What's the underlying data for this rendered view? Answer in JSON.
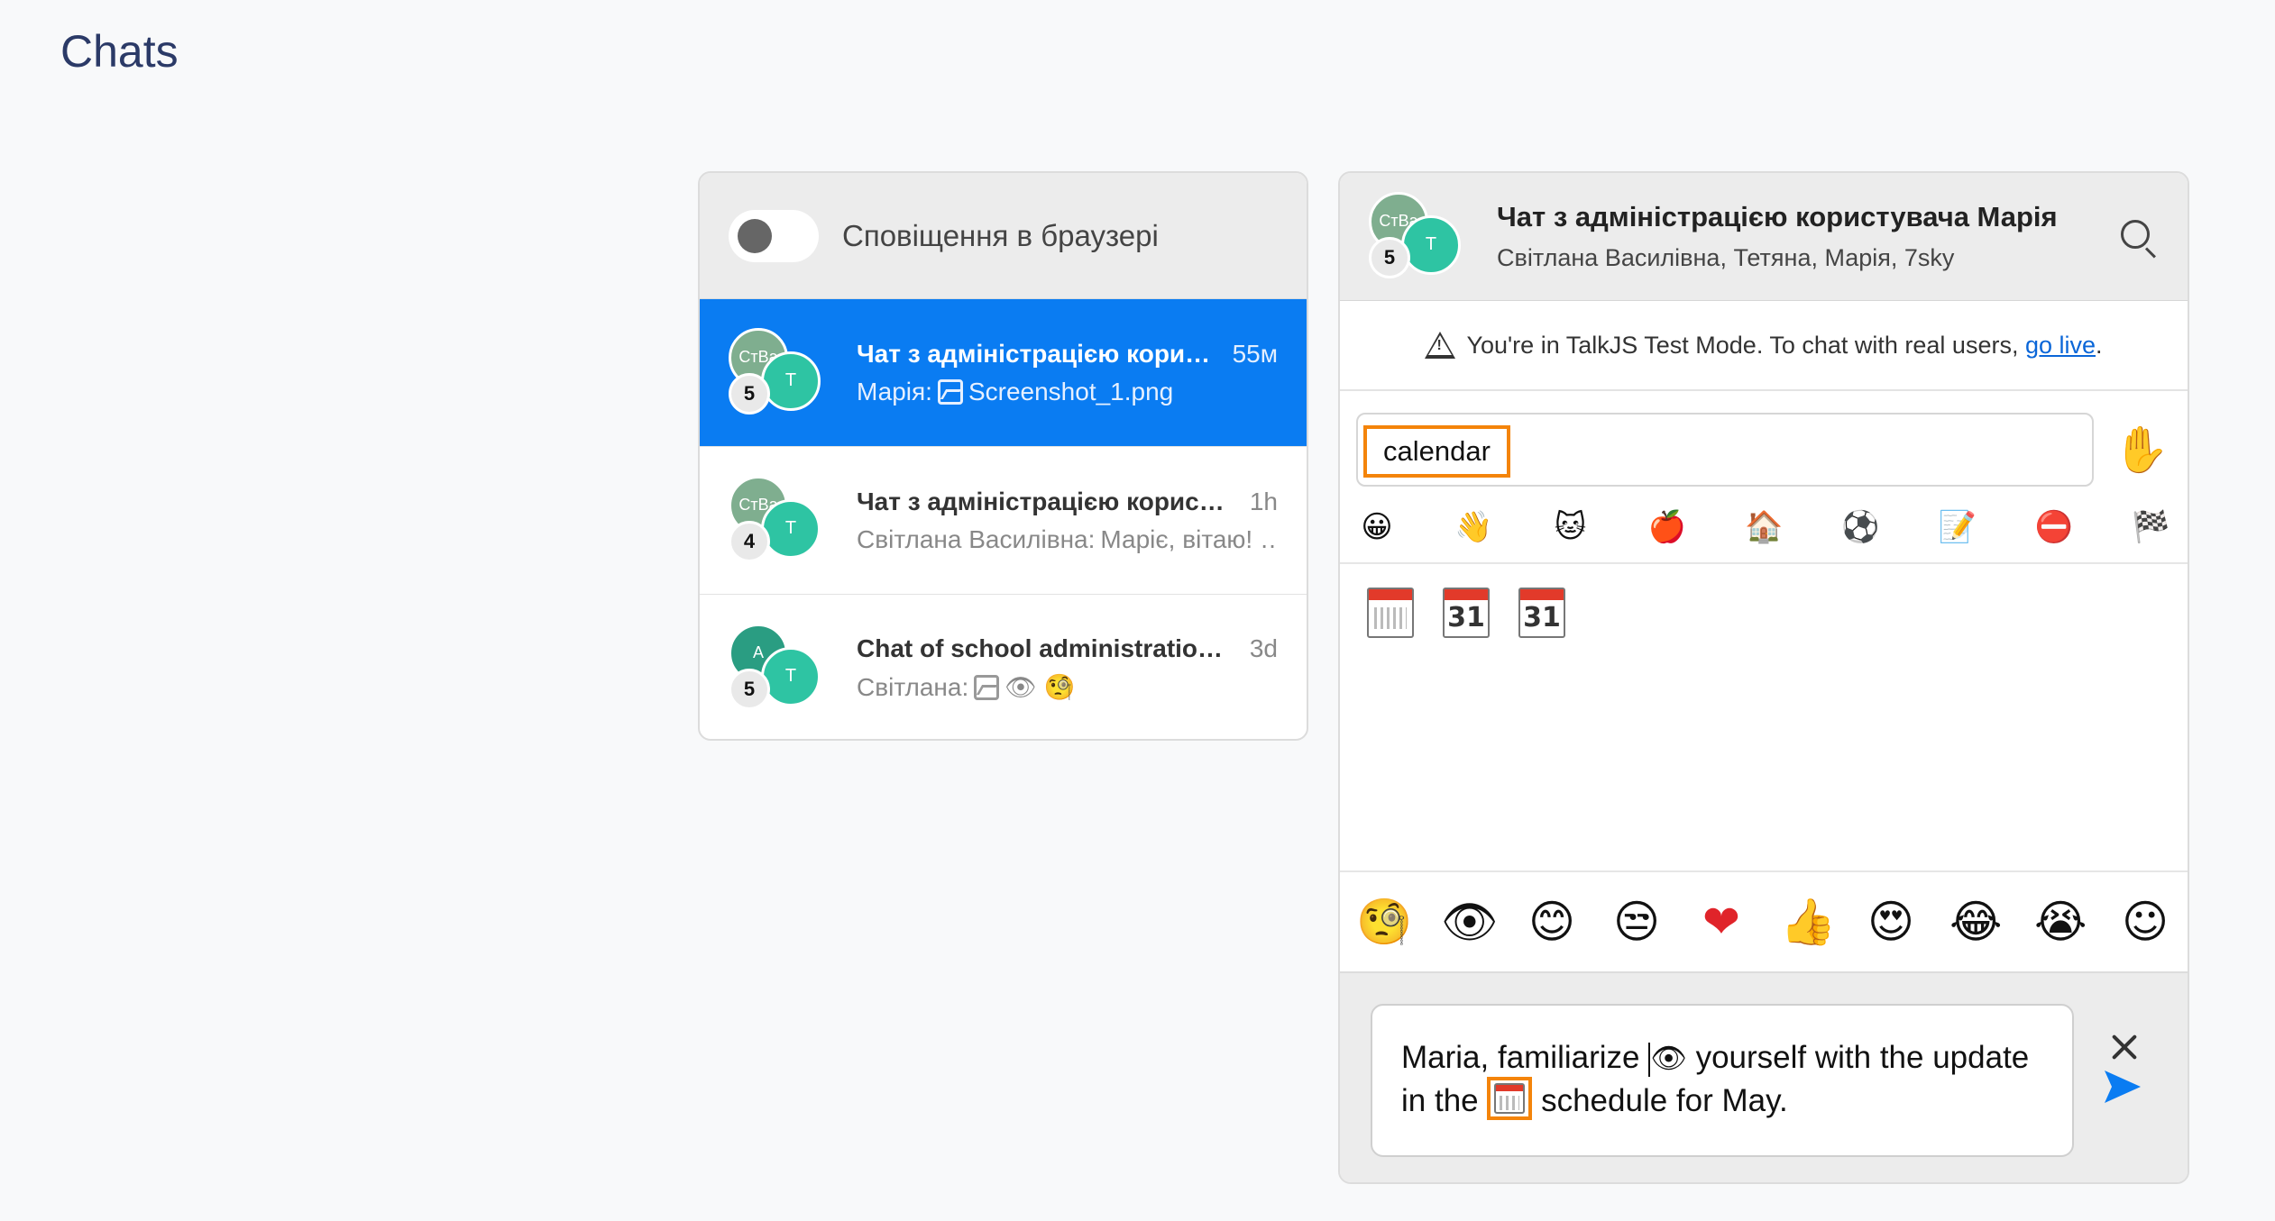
{
  "page": {
    "title": "Chats"
  },
  "inbox": {
    "notification_toggle_label": "Сповіщення в браузері",
    "conversations": [
      {
        "title": "Чат з адміністрацією користувача Марія",
        "time": "55м",
        "subtitle_sender": "Марія:",
        "subtitle_text": "Screenshot_1.png",
        "avatar_back": "СтВа",
        "avatar_front": "Т",
        "count": "5",
        "avatar_back_color": "#7fae8f",
        "selected": true
      },
      {
        "title": "Чат з адміністрацією користувача Марія",
        "time": "1h",
        "subtitle_sender": "Світлана Василівна:",
        "subtitle_text": "Маріє, вітаю! …",
        "avatar_back": "СтВа",
        "avatar_front": "Т",
        "count": "4",
        "avatar_back_color": "#7fae8f",
        "selected": false
      },
      {
        "title": "Chat of school administration E…",
        "time": "3d",
        "subtitle_sender": "Світлана:",
        "subtitle_text": "👁 🧐",
        "avatar_back": "А",
        "avatar_front": "Т",
        "count": "5",
        "avatar_back_color": "#2a9d82",
        "selected": false
      }
    ]
  },
  "chat": {
    "title": "Чат з адміністрацією користувача Марія",
    "participants": "Світлана Василівна, Тетяна, Марія, 7sky",
    "avatar_back": "СтВа",
    "avatar_front": "Т",
    "count": "5",
    "testmode_text": "You're in TalkJS Test Mode. To chat with real users,",
    "testmode_link": "go live",
    "testmode_end": ".",
    "emoji_search_value": "calendar",
    "skin_tone_emoji": "✋",
    "categories": [
      "😀",
      "👋",
      "🐱",
      "🍎",
      "🏠",
      "⚽",
      "📝",
      "⛔",
      "🏁"
    ],
    "results": [
      "31",
      "31"
    ],
    "quick_emojis": [
      "🧐",
      "👁",
      "😊",
      "😒",
      "❤",
      "👍",
      "😍",
      "😂",
      "😭",
      "☺"
    ],
    "message_part1": "Maria, familiarize",
    "message_eye": "👁",
    "message_part2": "yourself with the update in the",
    "message_part3": "schedule for May.",
    "colors": {
      "accent": "#0a7cf2",
      "highlight": "#f4840a",
      "title": "#2b3a67"
    }
  }
}
